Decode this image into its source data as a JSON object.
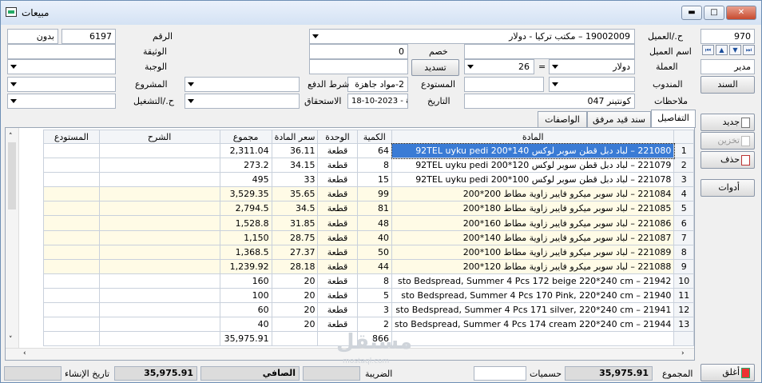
{
  "window": {
    "title": "مبيعات",
    "min": "▬",
    "max": "□",
    "close": "✕"
  },
  "header": {
    "number_label": "الرقم",
    "number_value": "6197",
    "number_suffix": "بدون",
    "document_label": "الوثيقة",
    "document_value": "",
    "face_label": "الوجبة",
    "face_value": "",
    "project_label": "المشروع",
    "project_value": "",
    "operation_label": "ح./التشغيل",
    "operation_value": "",
    "customer_label": "ح./العميل",
    "customer_value": "19002009 – مكتب تركيا - دولار",
    "customer_code": "970",
    "customer_name_label": "اسم العميل",
    "customer_name_value": "",
    "discount_label": "خصم",
    "discount_value": "0",
    "pay_button": "تسديد",
    "currency_label": "العملة",
    "currency_value": "دولار",
    "rate_value": "26",
    "rate_eq": "=",
    "rep_label": "المندوب",
    "rep_value": "",
    "warehouse_label": "المستودع",
    "warehouse_value": "",
    "pay_terms_label": "شرط الدفع",
    "pay_terms_value": "2-مواد جاهزة",
    "notes_label": "ملاحظات",
    "notes_value": "كونتينر 047",
    "date_label": "التاريخ",
    "date_value": "",
    "due_label": "الاستحقاق",
    "due_value": "18-10-2023 - ay",
    "manager_value": "مدير",
    "bond_button": "السند"
  },
  "tabs": [
    "التفاصيل",
    "سند قيد مرفق",
    "الواصفات"
  ],
  "grid": {
    "columns": {
      "item": "المادة",
      "qty": "الكمية",
      "unit": "الوحدة",
      "price": "سعر المادة",
      "total": "مجموع",
      "desc": "الشرح",
      "store": "المستودع"
    },
    "rows": [
      {
        "n": "1",
        "item": "221080 – لباد دبل قطن سوبر لوكس 140*200 92TEL uyku pedi",
        "qty": "64",
        "unit": "قطعة",
        "price": "36.11",
        "total": "2,311.04"
      },
      {
        "n": "2",
        "item": "221079 – لباد دبل قطن سوبر لوكس 120*200 92TEL uyku pedi",
        "qty": "8",
        "unit": "قطعة",
        "price": "34.15",
        "total": "273.2"
      },
      {
        "n": "3",
        "item": "221078 – لباد دبل قطن سوبر لوكس 100*200 92TEL uyku pedi",
        "qty": "15",
        "unit": "قطعة",
        "price": "33",
        "total": "495"
      },
      {
        "n": "4",
        "item": "221084 – لباد سوبر ميكرو فايبر زاوية مطاط 200*200",
        "qty": "99",
        "unit": "قطعة",
        "price": "35.65",
        "total": "3,529.35"
      },
      {
        "n": "5",
        "item": "221085 – لباد سوبر ميكرو فايبر زاوية مطاط 180*200",
        "qty": "81",
        "unit": "قطعة",
        "price": "34.5",
        "total": "2,794.5"
      },
      {
        "n": "6",
        "item": "221086 – لباد سوبر ميكرو فايبر زاوية مطاط 160*200",
        "qty": "48",
        "unit": "قطعة",
        "price": "31.85",
        "total": "1,528.8"
      },
      {
        "n": "7",
        "item": "221087 – لباد سوبر ميكرو فايبر زاوية مطاط 140*200",
        "qty": "40",
        "unit": "قطعة",
        "price": "28.75",
        "total": "1,150"
      },
      {
        "n": "8",
        "item": "221089 – لباد سوبر ميكرو فايبر زاوية مطاط 100*200",
        "qty": "50",
        "unit": "قطعة",
        "price": "27.37",
        "total": "1,368.5"
      },
      {
        "n": "9",
        "item": "221088 – لباد سوبر ميكرو فايبر زاوية مطاط 120*200",
        "qty": "44",
        "unit": "قطعة",
        "price": "28.18",
        "total": "1,239.92"
      },
      {
        "n": "10",
        "item": "21942 – sto Bedspread, Summer 4 Pcs 172 beige 220*240 cm",
        "qty": "8",
        "unit": "قطعة",
        "price": "20",
        "total": "160"
      },
      {
        "n": "11",
        "item": "21940 – sto Bedspread, Summer 4 Pcs 170 Pink, 220*240 cm",
        "qty": "5",
        "unit": "قطعة",
        "price": "20",
        "total": "100"
      },
      {
        "n": "12",
        "item": "21941 – sto Bedspread, Summer 4 Pcs 171 silver, 220*240 cm",
        "qty": "3",
        "unit": "قطعة",
        "price": "20",
        "total": "60"
      },
      {
        "n": "13",
        "item": "21944 – sto Bedspread, Summer 4 Pcs 174 cream 220*240 cm",
        "qty": "2",
        "unit": "قطعة",
        "price": "20",
        "total": "40"
      }
    ],
    "total_qty": "866",
    "total_sum": "35,975.91"
  },
  "side_buttons": {
    "new": "جديد",
    "save": "تخزين",
    "delete": "حذف",
    "tools": "أدوات",
    "close": "أغلق"
  },
  "footer": {
    "sum_label": "المجموع",
    "sum_value": "35,975.91",
    "discounts_label": "حسميات",
    "discounts_value": "",
    "tax_label": "الضريبة",
    "tax_value": "",
    "net_label": "الصافي",
    "net_value": "35,975.91",
    "created_label": "تاريخ الإنشاء",
    "created_value": ""
  },
  "watermark": {
    "text": "مستقل",
    "sub": "mostaql.com"
  }
}
